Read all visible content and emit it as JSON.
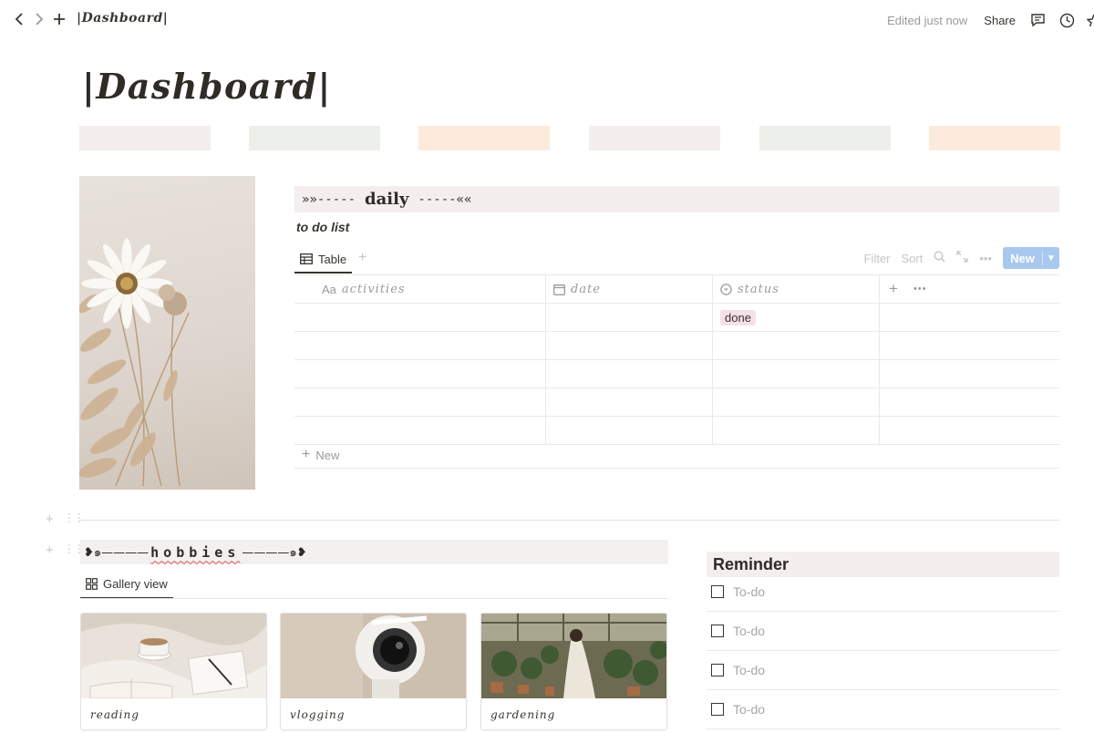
{
  "topbar": {
    "breadcrumb": "|Dashboard|",
    "edited": "Edited just now",
    "share": "Share"
  },
  "page": {
    "title": "|Dashboard|",
    "strip_colors": [
      "#f4eeee",
      "#edf0ea",
      "#fcebdc",
      "#f4eeee",
      "#edf0ea",
      "#fcebdc"
    ]
  },
  "daily": {
    "left": "»»-----",
    "word": "daily",
    "right": "-----««",
    "subtitle": "to do list",
    "view_tab": "Table",
    "tools": {
      "filter": "Filter",
      "sort": "Sort",
      "new": "New"
    },
    "columns": [
      {
        "aa": "Aa",
        "label": "activities"
      },
      {
        "label": "date"
      },
      {
        "label": "status"
      }
    ],
    "rows": [
      {
        "activities": "",
        "date": "",
        "status": "done"
      },
      {
        "activities": "",
        "date": "",
        "status": ""
      },
      {
        "activities": "",
        "date": "",
        "status": ""
      },
      {
        "activities": "",
        "date": "",
        "status": ""
      },
      {
        "activities": "",
        "date": "",
        "status": ""
      }
    ],
    "add_new": "New"
  },
  "hobbies": {
    "left": "❥๑————",
    "word": "hobbies",
    "right": "————๑❥",
    "view_tab": "Gallery view",
    "cards": [
      {
        "caption": "reading"
      },
      {
        "caption": "vlogging"
      },
      {
        "caption": "gardening"
      }
    ]
  },
  "reminder": {
    "title": "Reminder",
    "items": [
      "To-do",
      "To-do",
      "To-do",
      "To-do"
    ]
  }
}
